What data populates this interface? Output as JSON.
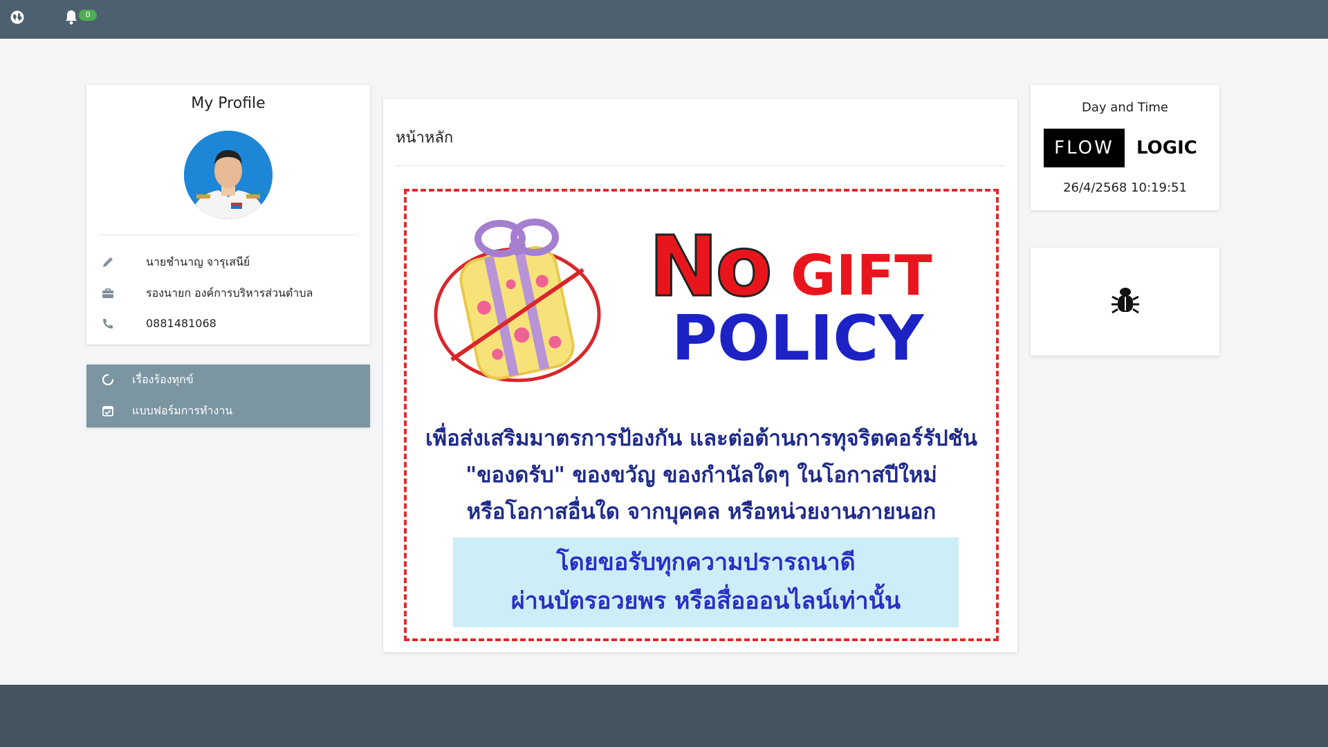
{
  "topbar": {
    "globe_icon": "globe-icon",
    "bell_icon": "bell-icon",
    "notification_count": "0"
  },
  "profile": {
    "title": "My Profile",
    "name": "นายชำนาญ จารุเสนีย์",
    "position": "รองนายก องค์การบริหารส่วนตำบล",
    "phone": "0881481068"
  },
  "menu": {
    "items": [
      {
        "label": "เรื่องร้องทุกข์",
        "icon": "circle-notch-icon"
      },
      {
        "label": "แบบฟอร์มการทำงาน",
        "icon": "calendar-check-icon"
      }
    ]
  },
  "main": {
    "title": "หน้าหลัก",
    "poster": {
      "heading_no": "No",
      "heading_gift": "GIFT",
      "heading_policy": "POLICY",
      "line1": "เพื่อส่งเสริมมาตรการป้องกัน และต่อต้านการทุจริตคอร์รัปชัน",
      "line2": "\"ของดรับ\" ของขวัญ ของกำนัลใดๆ ในโอกาสปีใหม่",
      "line3": "หรือโอกาสอื่นใด จากบุคคล หรือหน่วยงานภายนอก",
      "box_line1": "โดยขอรับทุกความปรารถนาดี",
      "box_line2": "ผ่านบัตรอวยพร หรือสื่อออนไลน์เท่านั้น"
    }
  },
  "daytime": {
    "title": "Day and Time",
    "logo_flow": "FLOW",
    "logo_logic": "LOGIC",
    "datetime": "26/4/2568 10:19:51"
  },
  "colors": {
    "topbar": "#4d6070",
    "footer": "#45545f",
    "menu": "#7b95a1",
    "poster_red": "#e8161c",
    "poster_blue": "#1c22c4"
  }
}
